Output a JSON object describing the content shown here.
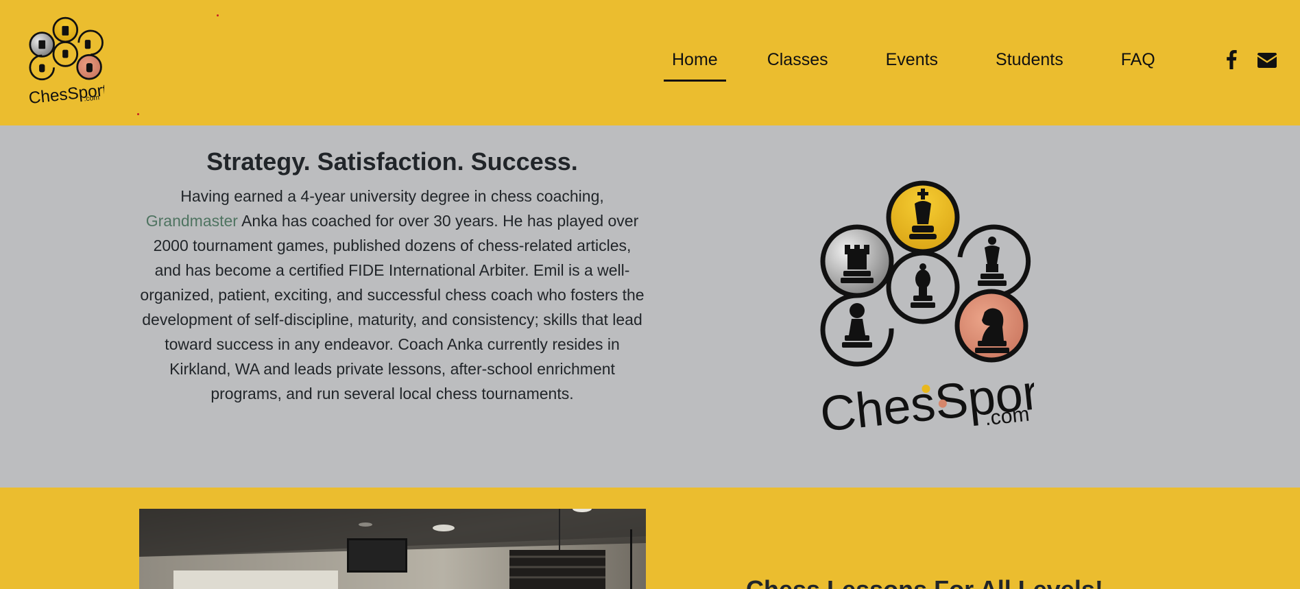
{
  "header": {
    "logo": {
      "alt": "ChessSport.com",
      "wordmark": "ChesSport",
      "domain_suffix": ".com"
    },
    "nav": [
      {
        "label": "Home",
        "active": true
      },
      {
        "label": "Classes",
        "active": false
      },
      {
        "label": "Events",
        "active": false
      },
      {
        "label": "Students",
        "active": false
      },
      {
        "label": "FAQ",
        "active": false
      }
    ],
    "social": [
      {
        "icon": "facebook-icon"
      },
      {
        "icon": "envelope-icon"
      }
    ]
  },
  "hero": {
    "title": "Strategy. Satisfaction. Success.",
    "text_before_link": "Having earned a 4-year university degree in chess coaching, ",
    "link_text": "Grandmaster",
    "text_after_link": " Anka has coached for over 30 years. He has played over 2000 tournament games, published dozens of chess-related articles, and has become a certified FIDE International Arbiter. Emil is a well-organized, patient, exciting, and successful chess coach who fosters the development of self-discipline, maturity, and consistency; skills that lead toward success in any endeavor. Coach Anka currently resides in Kirkland, WA and leads private lessons, after-school enrichment programs, and run several local chess tournaments.",
    "logo": {
      "wordmark": "ChesSport",
      "domain_suffix": ".com"
    }
  },
  "lessons": {
    "title": "Chess Lessons For All Levels!"
  },
  "colors": {
    "brand_yellow": "#ebbd2f",
    "hero_gray": "#bcbdbf",
    "link_green": "#4f7461",
    "text_dark": "#212529",
    "piece_gray": "#9a9a9a",
    "piece_gold": "#e8b81e",
    "piece_copper": "#d6866b"
  }
}
